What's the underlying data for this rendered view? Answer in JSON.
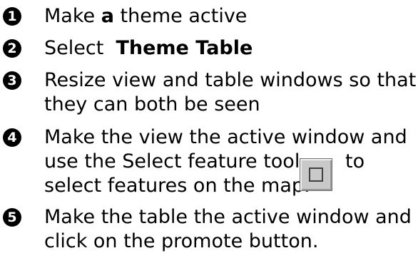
{
  "steps": [
    {
      "number": "1",
      "lines": [
        {
          "parts": [
            "Make ",
            "a",
            " theme active"
          ]
        }
      ]
    },
    {
      "number": "2",
      "lines": [
        {
          "parts": [
            "Select  ",
            "Theme Table"
          ]
        }
      ]
    },
    {
      "number": "3",
      "lines": [
        {
          "text": "Resize view and table windows so that"
        },
        {
          "text": "they can both be seen"
        }
      ]
    },
    {
      "number": "4",
      "lines": [
        {
          "text": "Make the view the active window and"
        },
        {
          "text": "use the Select feature tool"
        },
        {
          "text": "to"
        },
        {
          "text": "select features on the map."
        }
      ]
    },
    {
      "number": "5",
      "lines": [
        {
          "text": "Make the table the active window and"
        },
        {
          "text": "click on the promote button."
        }
      ]
    }
  ],
  "icons": {
    "select_feature_tool": "select-feature-tool-icon"
  }
}
